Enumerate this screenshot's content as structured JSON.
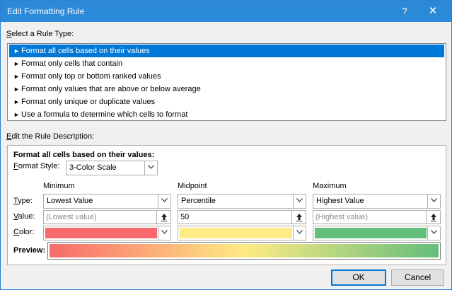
{
  "window": {
    "title": "Edit Formatting Rule",
    "help_glyph": "?",
    "close_glyph": "✕"
  },
  "rule_type": {
    "heading": "Select a Rule Type:",
    "items": [
      "Format all cells based on their values",
      "Format only cells that contain",
      "Format only top or bottom ranked values",
      "Format only values that are above or below average",
      "Format only unique or duplicate values",
      "Use a formula to determine which cells to format"
    ],
    "selected_index": 0,
    "bullet": "►"
  },
  "description": {
    "heading": "Edit the Rule Description:",
    "subheading": "Format all cells based on their values:",
    "format_style_label": "Format Style:",
    "format_style_value": "3-Color Scale",
    "row_labels": {
      "type": "Type:",
      "value": "Value:",
      "color": "Color:"
    },
    "columns": [
      {
        "header": "Minimum",
        "type": "Lowest Value",
        "value": "(Lowest value)",
        "value_is_placeholder": true,
        "color": "#f8696b"
      },
      {
        "header": "Midpoint",
        "type": "Percentile",
        "value": "50",
        "value_is_placeholder": false,
        "color": "#ffeb84"
      },
      {
        "header": "Maximum",
        "type": "Highest Value",
        "value": "(Highest value)",
        "value_is_placeholder": true,
        "color": "#63be7b"
      }
    ],
    "preview_label": "Preview:"
  },
  "buttons": {
    "ok": "OK",
    "cancel": "Cancel"
  },
  "colors": {
    "title_bar": "#2b8ad8",
    "selection": "#0078d7"
  }
}
